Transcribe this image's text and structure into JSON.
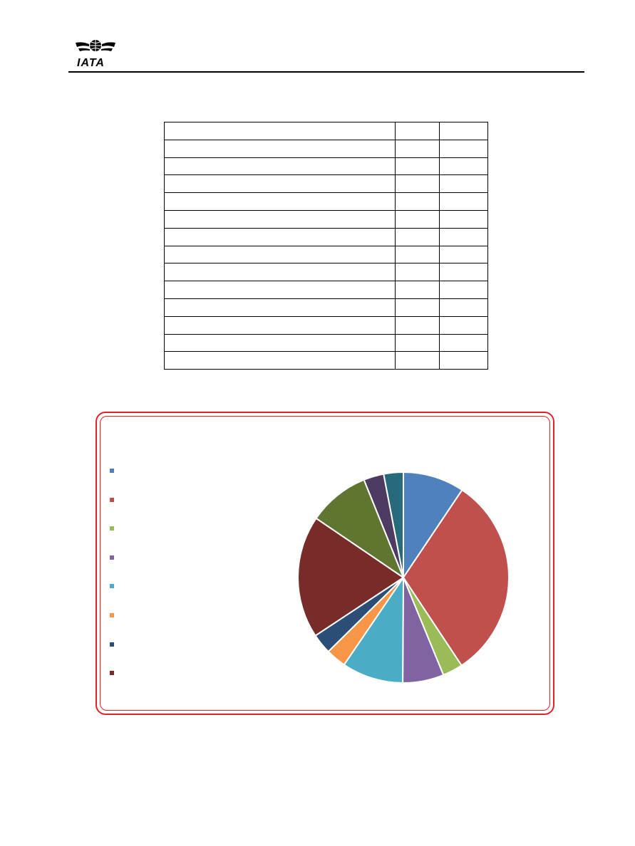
{
  "header": {
    "logo_text": "IATA"
  },
  "table": {
    "rows": [
      [
        "",
        "",
        ""
      ],
      [
        "",
        "",
        ""
      ],
      [
        "",
        "",
        ""
      ],
      [
        "",
        "",
        ""
      ],
      [
        "",
        "",
        ""
      ],
      [
        "",
        "",
        ""
      ],
      [
        "",
        "",
        ""
      ],
      [
        "",
        "",
        ""
      ],
      [
        "",
        "",
        ""
      ],
      [
        "",
        "",
        ""
      ],
      [
        "",
        "",
        ""
      ],
      [
        "",
        "",
        ""
      ],
      [
        "",
        "",
        ""
      ],
      [
        "",
        "",
        ""
      ]
    ]
  },
  "chart_data": {
    "type": "pie",
    "title": "",
    "legend_position": "left",
    "slices": [
      {
        "value": 9.4,
        "color": "#4f81bd"
      },
      {
        "value": 31.3,
        "color": "#c0504d"
      },
      {
        "value": 3.1,
        "color": "#9bbb59"
      },
      {
        "value": 6.3,
        "color": "#8064a2"
      },
      {
        "value": 9.4,
        "color": "#4bacc6"
      },
      {
        "value": 3.1,
        "color": "#f79646"
      },
      {
        "value": 3.1,
        "color": "#2c4d75"
      },
      {
        "value": 18.8,
        "color": "#772c2a"
      },
      {
        "value": 9.4,
        "color": "#5f7530"
      },
      {
        "value": 3.1,
        "color": "#4d3b62"
      },
      {
        "value": 3.0,
        "color": "#276a7c"
      }
    ],
    "legend_colors": [
      "#4f81bd",
      "#c0504d",
      "#9bbb59",
      "#8064a2",
      "#4bacc6",
      "#f79646",
      "#2c4d75",
      "#772c2a"
    ],
    "legend_labels": [
      "",
      "",
      "",
      "",
      "",
      "",
      "",
      ""
    ]
  }
}
